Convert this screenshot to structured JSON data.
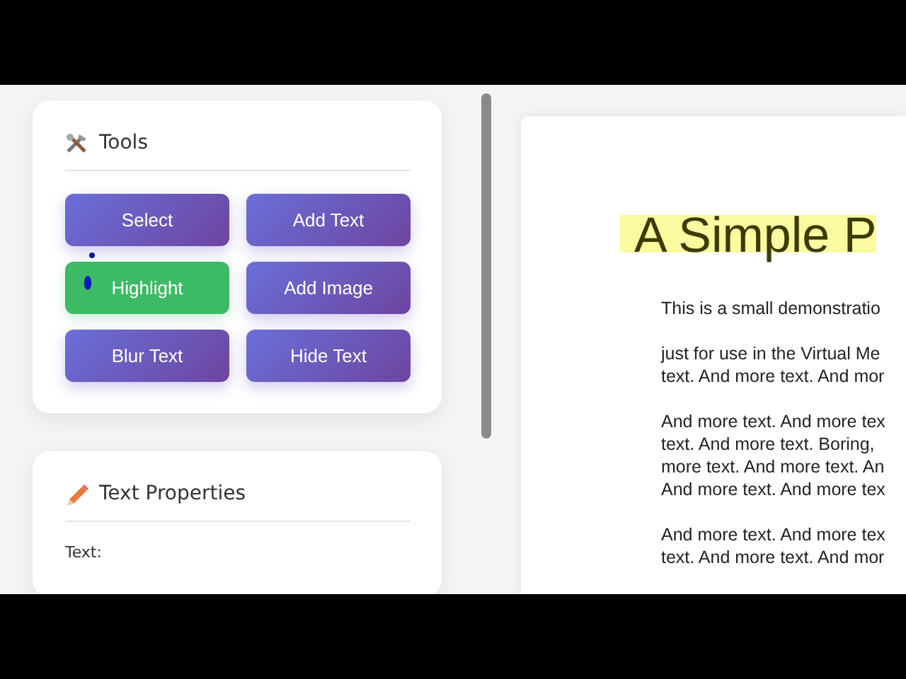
{
  "tools_card": {
    "title": "Tools",
    "buttons": [
      {
        "label": "Select",
        "selected": false
      },
      {
        "label": "Add Text",
        "selected": false
      },
      {
        "label": "Highlight",
        "selected": true
      },
      {
        "label": "Add Image",
        "selected": false
      },
      {
        "label": "Blur Text",
        "selected": false
      },
      {
        "label": "Hide Text",
        "selected": false
      }
    ]
  },
  "text_properties_card": {
    "title": "Text Properties",
    "field_label": "Text:"
  },
  "document": {
    "title": "A Simple P",
    "title_highlighted": true,
    "paragraphs": [
      [
        "This is a small demonstratio"
      ],
      [
        "just for use in the Virtual Me",
        "text. And more text. And mor"
      ],
      [
        "And more text. And more tex",
        "text. And more text. Boring,",
        "more text. And more text. An",
        "And more text. And more tex"
      ],
      [
        "And more text. And more tex",
        "text. And more text. And mor"
      ]
    ]
  }
}
